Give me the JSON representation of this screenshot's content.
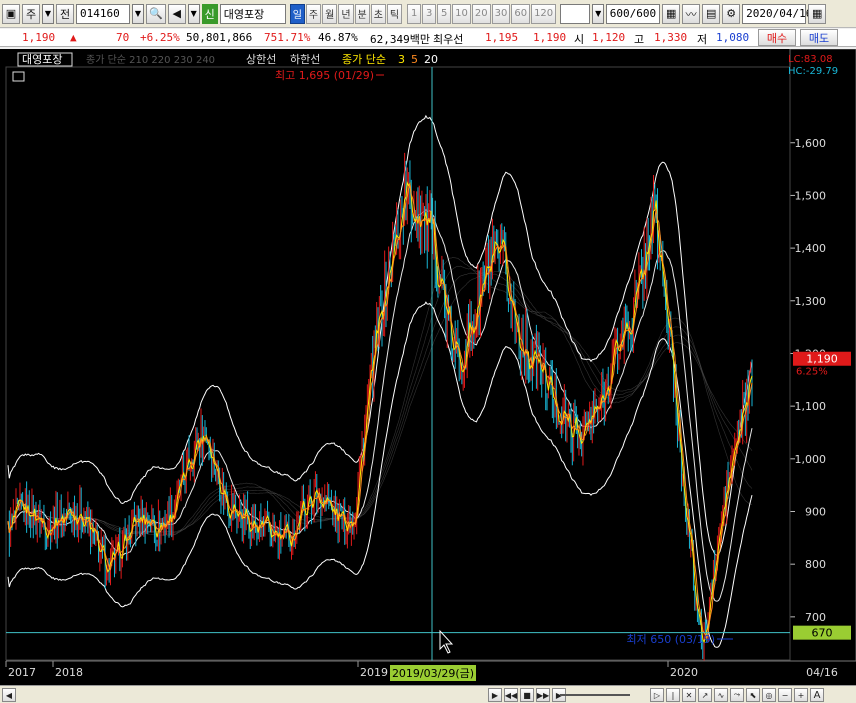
{
  "toolbar": {
    "type_label": "주",
    "market_label": "전",
    "code": "014160",
    "name_badge": "신",
    "name": "대영포장",
    "periods": [
      "일",
      "주",
      "월",
      "년",
      "분",
      "초",
      "틱"
    ],
    "active_period": "일",
    "numbers": [
      "1",
      "3",
      "5",
      "10",
      "20",
      "30",
      "60",
      "120"
    ],
    "count": "600",
    "count_total": "/600",
    "date": "2020/04/16"
  },
  "quote": {
    "price": "1,190",
    "arrow": "▲",
    "change": "70",
    "change_pct": "+6.25%",
    "volume": "50,801,866",
    "vol_ratio": "751.71%",
    "turnover": "46.87%",
    "amount": "62,349백만",
    "priority_label": "최우선",
    "best_bid": "1,195",
    "best_ask": "1,190",
    "open_label": "시",
    "open": "1,120",
    "high_label": "고",
    "high": "1,330",
    "low_label": "저",
    "low": "1,080",
    "buy_label": "매수",
    "sell_label": "매도"
  },
  "legend": {
    "name": "대영포장",
    "ma_label": "종가 단순 210 220 230 240",
    "limit_up": "상한선",
    "limit_down": "하한선",
    "short_ma_prefix": "종가 단순",
    "short_ma_3": "3",
    "short_ma_5": "5",
    "short_ma_20": "20"
  },
  "annotations": {
    "high": "최고 1,695 (01/29)",
    "low": "최저 650 (03/19)",
    "crosshair_date": "2019/03/29(금)",
    "crosshair_price": "670",
    "last_price": "1,190",
    "last_pct": "6.25%",
    "lc": "LC:83.08",
    "hc": "HC:-29.79"
  },
  "xaxis": {
    "labels": [
      "2017",
      "2018",
      "2019",
      "2020"
    ],
    "end_label": "04/16"
  },
  "colors": {
    "bg": "#000000",
    "up": "#e01a1a",
    "down": "#19b6d6",
    "ma3": "#ffe800",
    "ma5": "#ff8a20",
    "band": "#ffffff",
    "crosshair": "#41c2c8",
    "accent_green": "#3a9a2a"
  },
  "chart_data": {
    "type": "line",
    "yticks": [
      700,
      800,
      900,
      1000,
      1100,
      1200,
      1300,
      1400,
      1500,
      1600
    ],
    "ylim": [
      620,
      1740
    ],
    "x": [
      "2017-03",
      "2017-06",
      "2017-09",
      "2017-12",
      "2018-03",
      "2018-06",
      "2018-09",
      "2018-12",
      "2019-01",
      "2019-03",
      "2019-06",
      "2019-09",
      "2019-12",
      "2020-01",
      "2020-03",
      "2020-04"
    ],
    "series": [
      {
        "name": "종가",
        "values": [
          860,
          910,
          820,
          880,
          1030,
          840,
          900,
          915,
          1560,
          1220,
          1360,
          1080,
          1080,
          1470,
          650,
          1190
        ]
      }
    ],
    "high": {
      "value": 1695,
      "date": "01/29"
    },
    "low": {
      "value": 650,
      "date": "03/19"
    }
  }
}
